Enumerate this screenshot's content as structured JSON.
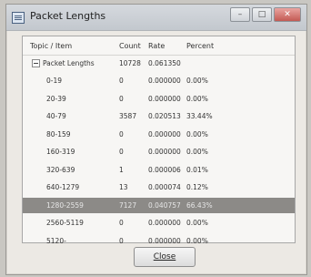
{
  "window": {
    "title": "Packet Lengths"
  },
  "controls": {
    "minimize": "–",
    "maximize": "□",
    "close": "✕"
  },
  "columns": {
    "topic": "Topic / Item",
    "count": "Count",
    "rate": "Rate",
    "percent": "Percent"
  },
  "group": {
    "label": "Packet Lengths",
    "count": "10728",
    "rate": "0.061350",
    "percent": ""
  },
  "rows": [
    {
      "label": "0-19",
      "count": "0",
      "rate": "0.000000",
      "percent": "0.00%"
    },
    {
      "label": "20-39",
      "count": "0",
      "rate": "0.000000",
      "percent": "0.00%"
    },
    {
      "label": "40-79",
      "count": "3587",
      "rate": "0.020513",
      "percent": "33.44%"
    },
    {
      "label": "80-159",
      "count": "0",
      "rate": "0.000000",
      "percent": "0.00%"
    },
    {
      "label": "160-319",
      "count": "0",
      "rate": "0.000000",
      "percent": "0.00%"
    },
    {
      "label": "320-639",
      "count": "1",
      "rate": "0.000006",
      "percent": "0.01%"
    },
    {
      "label": "640-1279",
      "count": "13",
      "rate": "0.000074",
      "percent": "0.12%"
    },
    {
      "label": "1280-2559",
      "count": "7127",
      "rate": "0.040757",
      "percent": "66.43%",
      "selected": true
    },
    {
      "label": "2560-5119",
      "count": "0",
      "rate": "0.000000",
      "percent": "0.00%"
    },
    {
      "label": "5120-",
      "count": "0",
      "rate": "0.000000",
      "percent": "0.00%"
    }
  ],
  "footer": {
    "close_label": "Close"
  }
}
